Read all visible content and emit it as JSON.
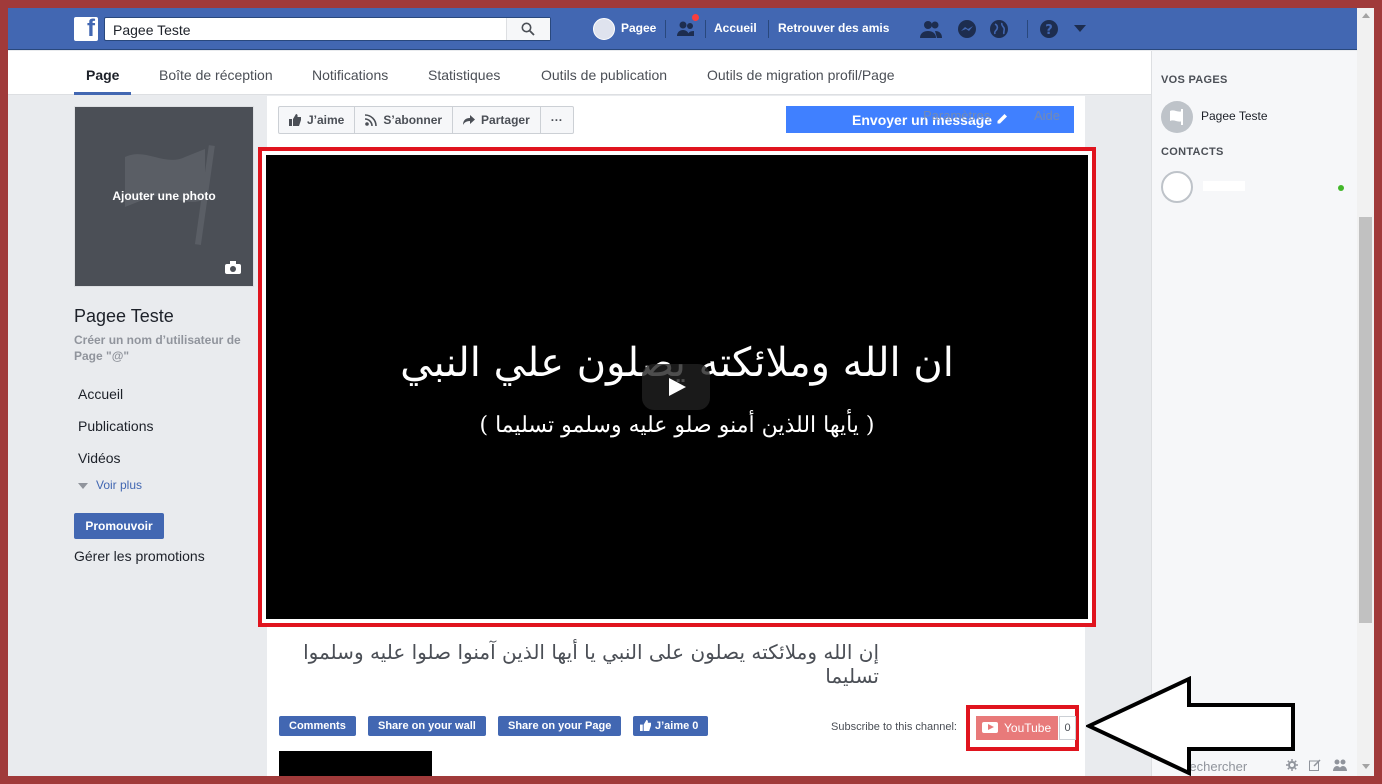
{
  "topbar": {
    "logo": "f",
    "search_value": "Pagee Teste",
    "profile_name": "Pagee",
    "home": "Accueil",
    "find_friends": "Retrouver des amis"
  },
  "tabs": [
    {
      "label": "Page",
      "active": true
    },
    {
      "label": "Boîte de réception"
    },
    {
      "label": "Notifications"
    },
    {
      "label": "Statistiques"
    },
    {
      "label": "Outils de publication"
    },
    {
      "label": "Outils de migration profil/Page"
    }
  ],
  "left": {
    "add_photo": "Ajouter une photo",
    "page_name": "Pagee Teste",
    "create_username": "Créer un nom d’utilisateur de Page \"@\"",
    "nav": [
      "Accueil",
      "Publications",
      "Vidéos"
    ],
    "see_more": "Voir plus",
    "promote": "Promouvoir",
    "manage_promotions": "Gérer les promotions"
  },
  "actions": {
    "like": "J’aime",
    "follow": "S’abonner",
    "share": "Partager",
    "more": "···",
    "send_message": "Envoyer un message",
    "settings_overlay": "Paramètres",
    "help_overlay": "Aide"
  },
  "video": {
    "line1": "ان الله وملائكته يصلون علي النبي",
    "line2": "( يأيها اللذين أمنو صلو عليه وسلمو تسليما )"
  },
  "post": {
    "caption": "إن الله وملائكته يصلون على النبي يا أيها الذين آمنوا صلوا عليه وسلموا تسليما",
    "buttons": [
      "Comments",
      "Share on your wall",
      "Share on your Page",
      "J’aime 0"
    ],
    "subscribe_label": "Subscribe to this channel:",
    "youtube_label": "YouTube",
    "youtube_count": "0"
  },
  "right": {
    "your_pages": "VOS PAGES",
    "page_name": "Pagee Teste",
    "contacts": "CONTACTS",
    "search_placeholder": "Rechercher"
  },
  "colors": {
    "facebook_blue": "#4267b2",
    "highlight_red": "#e0141e",
    "online_green": "#42b72a"
  }
}
